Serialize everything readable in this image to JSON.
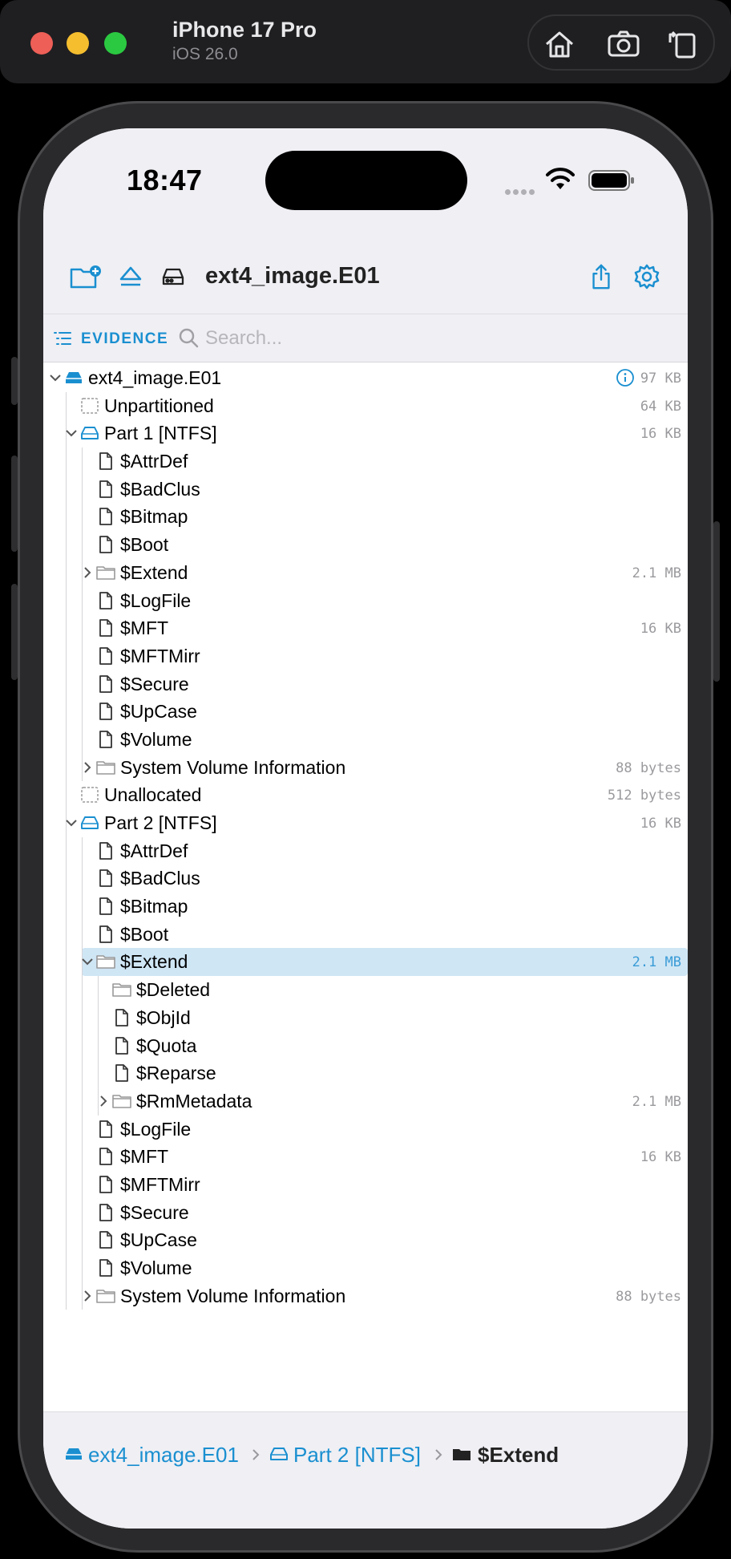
{
  "simulator": {
    "device_name": "iPhone 17 Pro",
    "os_version": "iOS 26.0",
    "tools": [
      "home-icon",
      "screenshot-icon",
      "rotate-icon"
    ]
  },
  "status_bar": {
    "time": "18:47"
  },
  "toolbar": {
    "title": "ext4_image.E01",
    "left_icons": [
      "folder-add-icon",
      "eject-icon",
      "disk-icon"
    ],
    "right_icons": [
      "share-icon",
      "settings-icon"
    ],
    "accent": "#1a8fd0"
  },
  "search": {
    "evidence_label": "EVIDENCE",
    "placeholder": "Search..."
  },
  "tree": [
    {
      "depth": 0,
      "chevron": "down",
      "icon": "drive-filled",
      "label": "ext4_image.E01",
      "size": "97 KB",
      "info": true
    },
    {
      "depth": 1,
      "chevron": "",
      "icon": "dashed-box",
      "label": "Unpartitioned",
      "size": "64 KB"
    },
    {
      "depth": 1,
      "chevron": "down",
      "icon": "drive-outline",
      "label": "Part 1 [NTFS]",
      "size": "16 KB"
    },
    {
      "depth": 2,
      "chevron": "",
      "icon": "doc",
      "label": "$AttrDef",
      "size": ""
    },
    {
      "depth": 2,
      "chevron": "",
      "icon": "doc",
      "label": "$BadClus",
      "size": ""
    },
    {
      "depth": 2,
      "chevron": "",
      "icon": "doc",
      "label": "$Bitmap",
      "size": ""
    },
    {
      "depth": 2,
      "chevron": "",
      "icon": "doc",
      "label": "$Boot",
      "size": ""
    },
    {
      "depth": 2,
      "chevron": "right",
      "icon": "folder",
      "label": "$Extend",
      "size": "2.1 MB"
    },
    {
      "depth": 2,
      "chevron": "",
      "icon": "doc",
      "label": "$LogFile",
      "size": ""
    },
    {
      "depth": 2,
      "chevron": "",
      "icon": "doc",
      "label": "$MFT",
      "size": "16 KB"
    },
    {
      "depth": 2,
      "chevron": "",
      "icon": "doc",
      "label": "$MFTMirr",
      "size": ""
    },
    {
      "depth": 2,
      "chevron": "",
      "icon": "doc",
      "label": "$Secure",
      "size": ""
    },
    {
      "depth": 2,
      "chevron": "",
      "icon": "doc",
      "label": "$UpCase",
      "size": ""
    },
    {
      "depth": 2,
      "chevron": "",
      "icon": "doc",
      "label": "$Volume",
      "size": ""
    },
    {
      "depth": 2,
      "chevron": "right",
      "icon": "folder",
      "label": "System Volume Information",
      "size": "88 bytes"
    },
    {
      "depth": 1,
      "chevron": "",
      "icon": "dashed-box",
      "label": "Unallocated",
      "size": "512 bytes"
    },
    {
      "depth": 1,
      "chevron": "down",
      "icon": "drive-outline",
      "label": "Part 2 [NTFS]",
      "size": "16 KB"
    },
    {
      "depth": 2,
      "chevron": "",
      "icon": "doc",
      "label": "$AttrDef",
      "size": ""
    },
    {
      "depth": 2,
      "chevron": "",
      "icon": "doc",
      "label": "$BadClus",
      "size": ""
    },
    {
      "depth": 2,
      "chevron": "",
      "icon": "doc",
      "label": "$Bitmap",
      "size": ""
    },
    {
      "depth": 2,
      "chevron": "",
      "icon": "doc",
      "label": "$Boot",
      "size": ""
    },
    {
      "depth": 2,
      "chevron": "down",
      "icon": "folder",
      "label": "$Extend",
      "size": "2.1 MB",
      "selected": true
    },
    {
      "depth": 3,
      "chevron": "",
      "icon": "folder",
      "label": "$Deleted",
      "size": ""
    },
    {
      "depth": 3,
      "chevron": "",
      "icon": "doc",
      "label": "$ObjId",
      "size": ""
    },
    {
      "depth": 3,
      "chevron": "",
      "icon": "doc",
      "label": "$Quota",
      "size": ""
    },
    {
      "depth": 3,
      "chevron": "",
      "icon": "doc",
      "label": "$Reparse",
      "size": ""
    },
    {
      "depth": 3,
      "chevron": "right",
      "icon": "folder",
      "label": "$RmMetadata",
      "size": "2.1 MB"
    },
    {
      "depth": 2,
      "chevron": "",
      "icon": "doc",
      "label": "$LogFile",
      "size": ""
    },
    {
      "depth": 2,
      "chevron": "",
      "icon": "doc",
      "label": "$MFT",
      "size": "16 KB"
    },
    {
      "depth": 2,
      "chevron": "",
      "icon": "doc",
      "label": "$MFTMirr",
      "size": ""
    },
    {
      "depth": 2,
      "chevron": "",
      "icon": "doc",
      "label": "$Secure",
      "size": ""
    },
    {
      "depth": 2,
      "chevron": "",
      "icon": "doc",
      "label": "$UpCase",
      "size": ""
    },
    {
      "depth": 2,
      "chevron": "",
      "icon": "doc",
      "label": "$Volume",
      "size": ""
    },
    {
      "depth": 2,
      "chevron": "right",
      "icon": "folder",
      "label": "System Volume Information",
      "size": "88 bytes"
    }
  ],
  "breadcrumb": {
    "items": [
      {
        "icon": "drive-filled",
        "label": "ext4_image.E01"
      },
      {
        "icon": "drive-outline",
        "label": "Part 2 [NTFS]"
      },
      {
        "icon": "folder-filled",
        "label": "$Extend"
      }
    ]
  }
}
